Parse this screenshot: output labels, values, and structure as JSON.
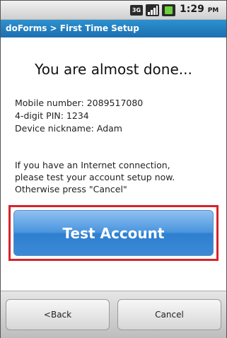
{
  "status_bar": {
    "network": "3G",
    "time": "1:29",
    "ampm": "PM",
    "icons": [
      "3g-icon",
      "signal-icon",
      "battery-icon"
    ]
  },
  "title_bar": {
    "title": "doForms > First Time Setup"
  },
  "content": {
    "heading": "You are almost done...",
    "mobile_number": "Mobile number: 2089517080",
    "pin": "4-digit PIN: 1234",
    "nickname": "Device nickname: Adam",
    "instruction_lines": [
      "If you have an Internet connection,",
      "please test your account setup now.",
      "Otherwise press \"Cancel\""
    ]
  },
  "actions": {
    "test_account": "Test Account",
    "back": "<Back",
    "cancel": "Cancel"
  },
  "colors": {
    "title_bar": "#1f78be",
    "primary_button": "#3a8ad8",
    "highlight": "#d8232a"
  }
}
